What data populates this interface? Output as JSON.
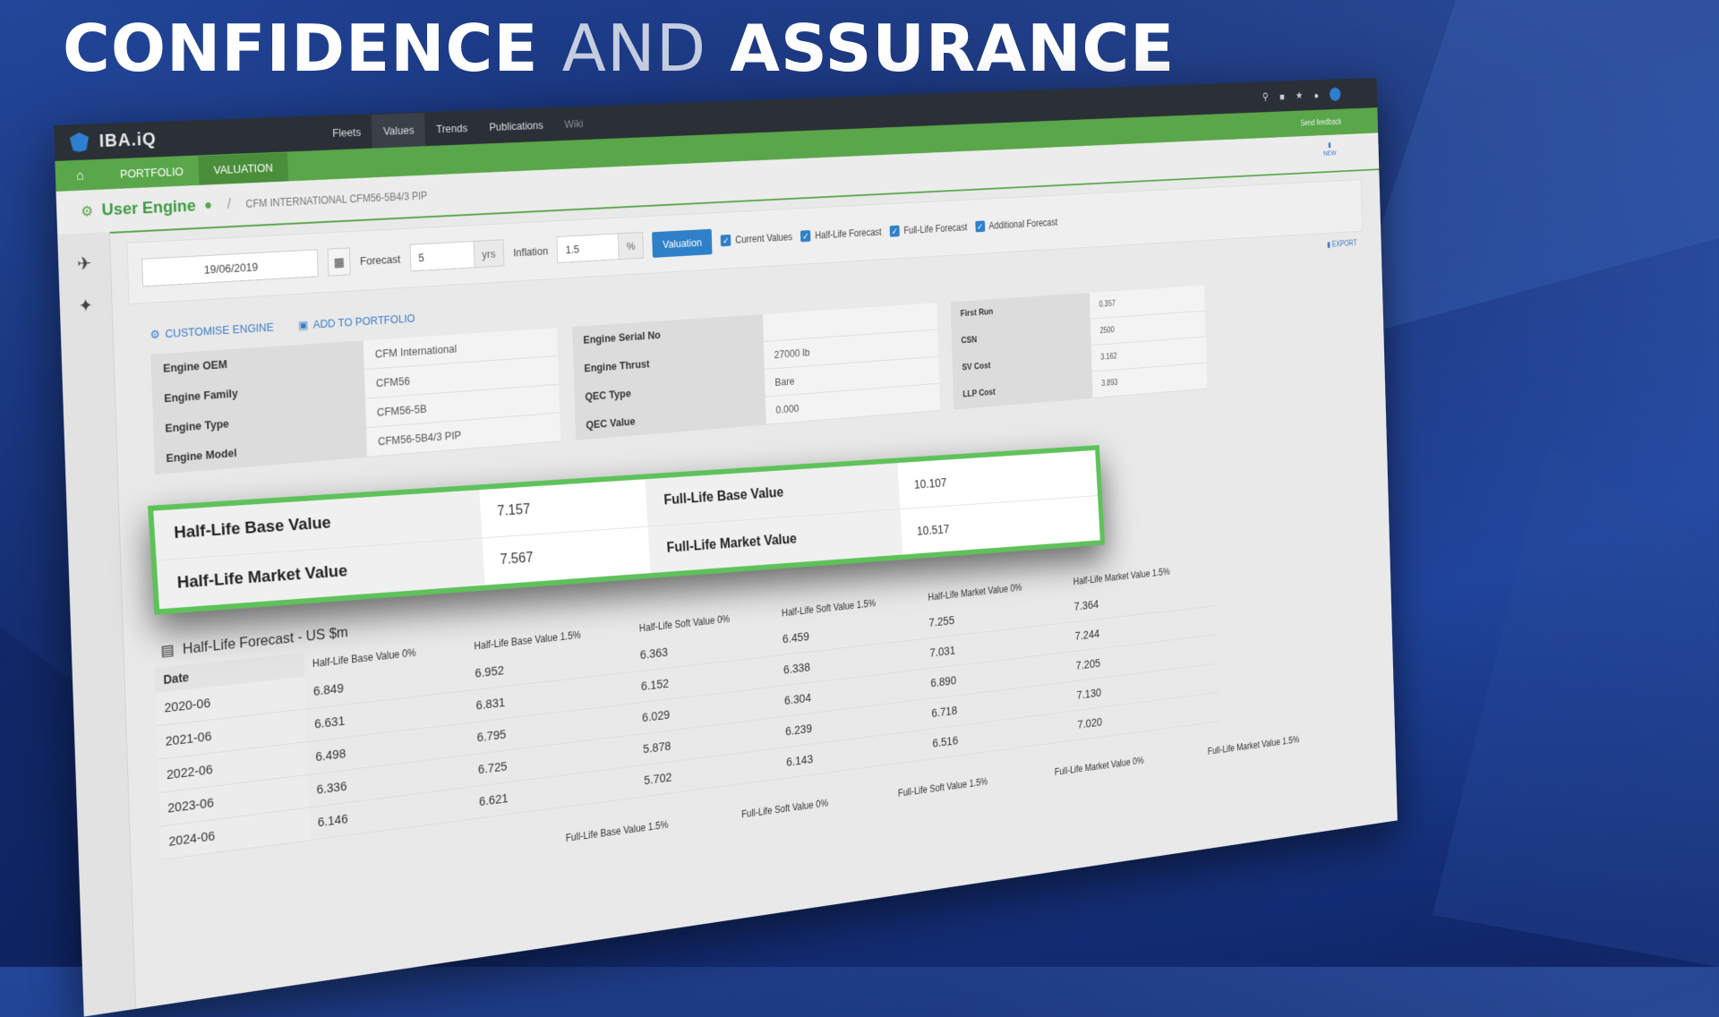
{
  "headline": {
    "part1": "CONFIDENCE",
    "part2": "AND",
    "part3": "ASSURANCE"
  },
  "app": {
    "name": "IBA.iQ",
    "nav": [
      "Fleets",
      "Values",
      "Trends",
      "Publications",
      "Wiki"
    ],
    "subnav": [
      "PORTFOLIO",
      "VALUATION"
    ],
    "feedback": "Send feedback",
    "new_label": "NEW"
  },
  "breadcrumb": {
    "title": "User Engine",
    "path": "CFM INTERNATIONAL CFM56-5B4/3 PIP"
  },
  "controls": {
    "date": "19/06/2019",
    "forecast_label": "Forecast",
    "forecast_value": "5",
    "forecast_unit": "yrs",
    "inflation_label": "Inflation",
    "inflation_value": "1.5",
    "inflation_unit": "%",
    "valuation_button": "Valuation",
    "checks": [
      "Current Values",
      "Half-Life Forecast",
      "Full-Life Forecast",
      "Additional Forecast"
    ],
    "export": "EXPORT"
  },
  "actions": {
    "customise": "CUSTOMISE ENGINE",
    "add": "ADD TO PORTFOLIO"
  },
  "specs": {
    "left": [
      {
        "k": "Engine OEM",
        "v": "CFM International"
      },
      {
        "k": "Engine Family",
        "v": "CFM56"
      },
      {
        "k": "Engine Type",
        "v": "CFM56-5B"
      },
      {
        "k": "Engine Model",
        "v": "CFM56-5B4/3 PIP"
      }
    ],
    "mid": [
      {
        "k": "Engine Serial No",
        "v": ""
      },
      {
        "k": "Engine Thrust",
        "v": "27000 lb"
      },
      {
        "k": "QEC Type",
        "v": "Bare"
      },
      {
        "k": "QEC Value",
        "v": "0.000"
      }
    ],
    "right": [
      {
        "k": "First Run",
        "v": "0.357"
      },
      {
        "k": "CSN",
        "v": "2500"
      },
      {
        "k": "SV Cost",
        "v": "3.162"
      },
      {
        "k": "LLP Cost",
        "v": "3.893"
      }
    ]
  },
  "highlight": {
    "half_base_label": "Half-Life Base Value",
    "half_base": "7.157",
    "half_market_label": "Half-Life Market Value",
    "half_market": "7.567",
    "full_base_label": "Full-Life Base Value",
    "full_base": "10.107",
    "full_market_label": "Full-Life Market Value",
    "full_market": "10.517"
  },
  "forecast": {
    "title": "Half-Life Forecast - US $m",
    "columns": [
      "Date",
      "Half-Life Base Value 0%",
      "Half-Life Base Value 1.5%",
      "Half-Life Soft Value 0%",
      "Half-Life Soft Value 1.5%",
      "Half-Life Market Value 0%",
      "Half-Life Market Value 1.5%"
    ],
    "rows": [
      [
        "2020-06",
        "6.849",
        "6.952",
        "6.363",
        "6.459",
        "7.255",
        "7.364"
      ],
      [
        "2021-06",
        "6.631",
        "6.831",
        "6.152",
        "6.338",
        "7.031",
        "7.244"
      ],
      [
        "2022-06",
        "6.498",
        "6.795",
        "6.029",
        "6.304",
        "6.890",
        "7.205"
      ],
      [
        "2023-06",
        "6.336",
        "6.725",
        "5.878",
        "6.239",
        "6.718",
        "7.130"
      ],
      [
        "2024-06",
        "6.146",
        "6.621",
        "5.702",
        "6.143",
        "6.516",
        "7.020"
      ]
    ],
    "full_headers": [
      "Full-Life Base Value 1.5%",
      "Full-Life Soft Value 0%",
      "Full-Life Soft Value 1.5%",
      "Full-Life Market Value 0%",
      "Full-Life Market Value 1.5%"
    ]
  }
}
